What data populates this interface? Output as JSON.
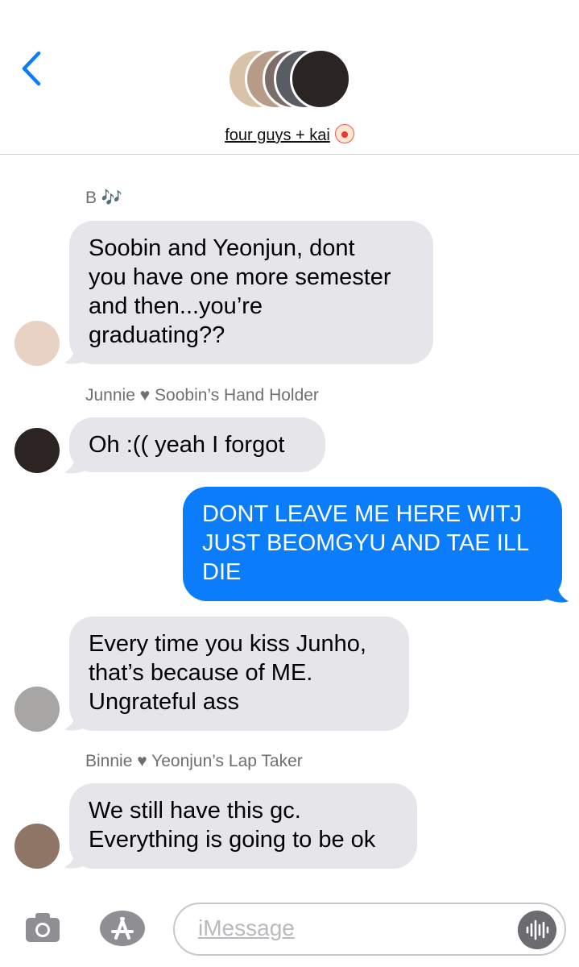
{
  "header": {
    "group_name": "four guys + kai",
    "group_emoji_icon": "clown-face-icon"
  },
  "messages": [
    {
      "sender": "B 🎶",
      "text": "Soobin and Yeonjun, dont\nyou have one more semester\nand then...you’re\ngraduating??",
      "direction": "incoming"
    },
    {
      "sender": "Junnie ♥ Soobin’s Hand Holder",
      "text": "Oh :(( yeah I forgot",
      "direction": "incoming"
    },
    {
      "text": "DONT LEAVE ME HERE WITJ\nJUST BEOMGYU AND TAE ILL\nDIE",
      "direction": "outgoing"
    },
    {
      "text": "Every time you kiss Junho,\nthat’s because of ME.\nUngrateful ass",
      "direction": "incoming"
    },
    {
      "sender": "Binnie ♥ Yeonjun’s Lap Taker",
      "text": "We still have this gc.\nEverything is going to be ok",
      "direction": "incoming"
    }
  ],
  "input": {
    "placeholder": "iMessage"
  },
  "colors": {
    "incoming_bubble": "#e5e5ea",
    "outgoing_bubble": "#0b7dfa",
    "ios_blue": "#0b7dfa"
  }
}
